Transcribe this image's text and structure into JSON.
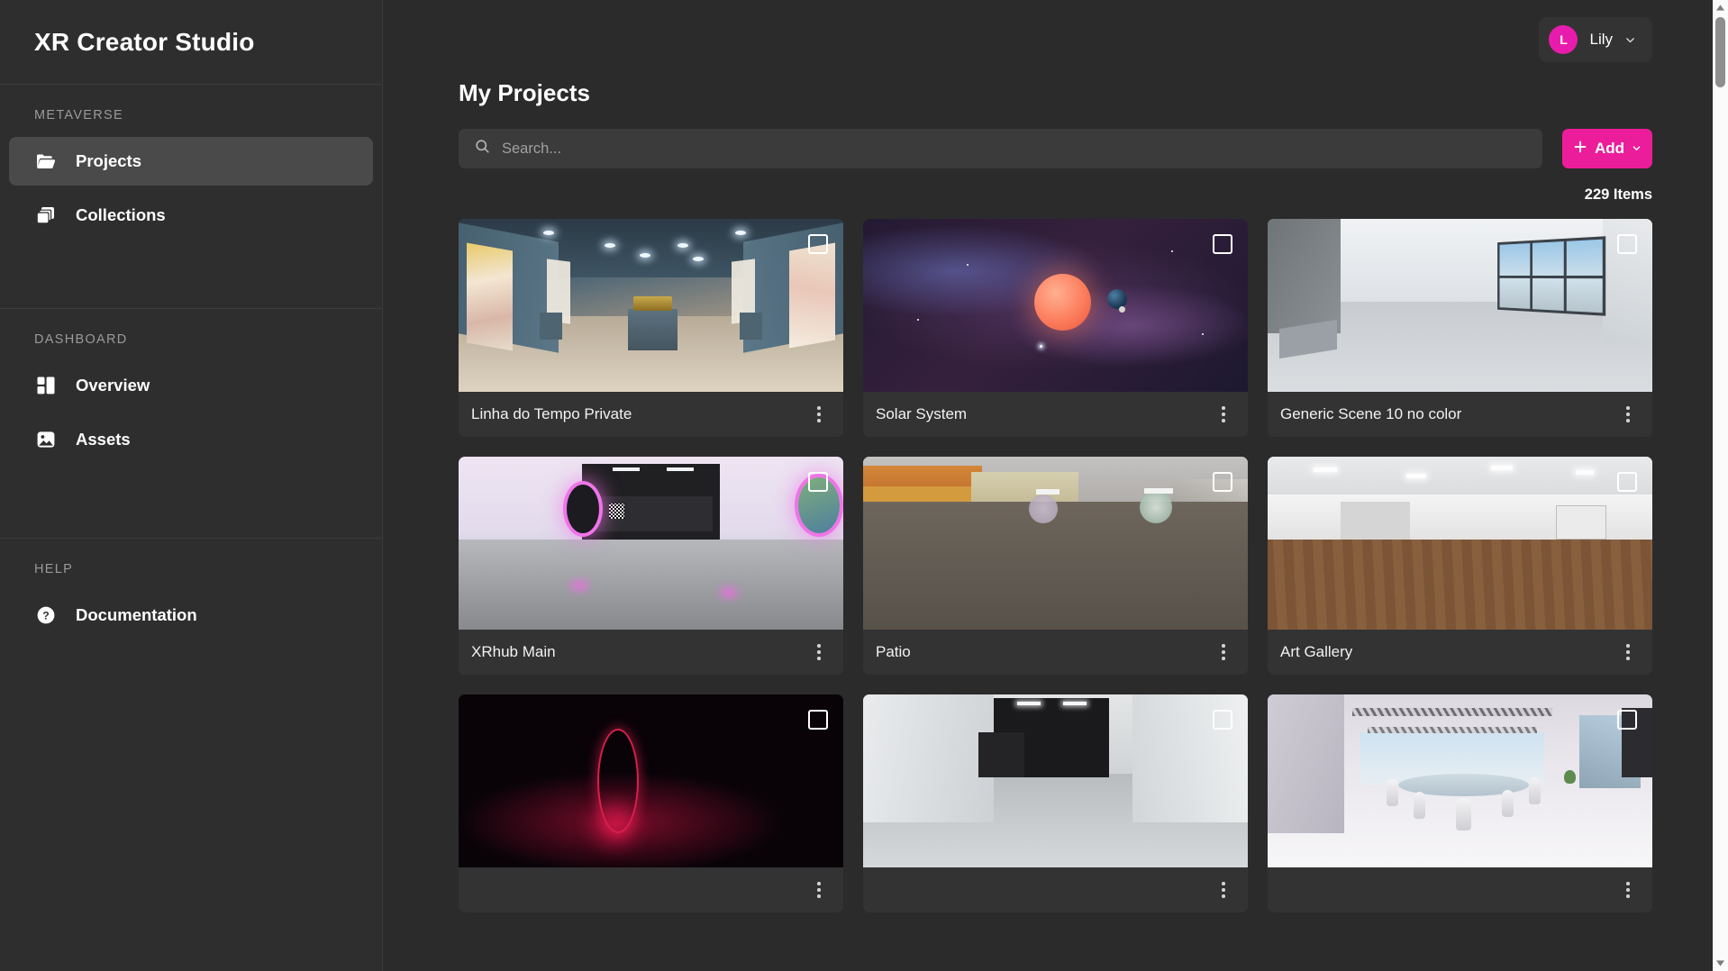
{
  "brand": {
    "title": "XR Creator Studio"
  },
  "sidebar": {
    "sections": [
      {
        "label": "METAVERSE",
        "items": [
          {
            "label": "Projects",
            "icon": "folder-open-icon",
            "active": true
          },
          {
            "label": "Collections",
            "icon": "collections-icon",
            "active": false
          }
        ]
      },
      {
        "label": "DASHBOARD",
        "items": [
          {
            "label": "Overview",
            "icon": "dashboard-grid-icon",
            "active": false
          },
          {
            "label": "Assets",
            "icon": "image-icon",
            "active": false
          }
        ]
      },
      {
        "label": "HELP",
        "items": [
          {
            "label": "Documentation",
            "icon": "question-circle-icon",
            "active": false
          }
        ]
      }
    ]
  },
  "topbar": {
    "user": {
      "initial": "L",
      "name": "Lily",
      "chevron_icon": "chevron-down-icon"
    }
  },
  "main": {
    "page_title": "My Projects",
    "search": {
      "value": "",
      "placeholder": "Search...",
      "icon": "search-icon"
    },
    "add_button": {
      "label": "Add",
      "plus_icon": "plus-icon",
      "chevron_icon": "chevron-down-icon"
    },
    "items_count": "229 Items"
  },
  "projects": [
    {
      "title": "Linha do Tempo Private",
      "scene": "museum",
      "selected": false
    },
    {
      "title": "Solar System",
      "scene": "space",
      "selected": false
    },
    {
      "title": "Generic Scene 10 no color",
      "scene": "room1",
      "selected": false
    },
    {
      "title": "XRhub Main",
      "scene": "xrhub",
      "selected": false
    },
    {
      "title": "Patio",
      "scene": "patio",
      "selected": false
    },
    {
      "title": "Art Gallery",
      "scene": "gallery",
      "selected": false
    },
    {
      "title": "",
      "scene": "ring",
      "selected": false
    },
    {
      "title": "",
      "scene": "corridor",
      "selected": false
    },
    {
      "title": "",
      "scene": "lounge",
      "selected": false
    }
  ],
  "colors": {
    "accent": "#ec1d9a",
    "sidebar_bg": "#2e2e2e",
    "main_bg": "#2b2b2b",
    "card_bg": "#333333",
    "active_nav": "#4a4a4a"
  },
  "scrollbar": {
    "up_icon": "scroll-up-arrow-icon",
    "down_icon": "scroll-down-arrow-icon"
  }
}
